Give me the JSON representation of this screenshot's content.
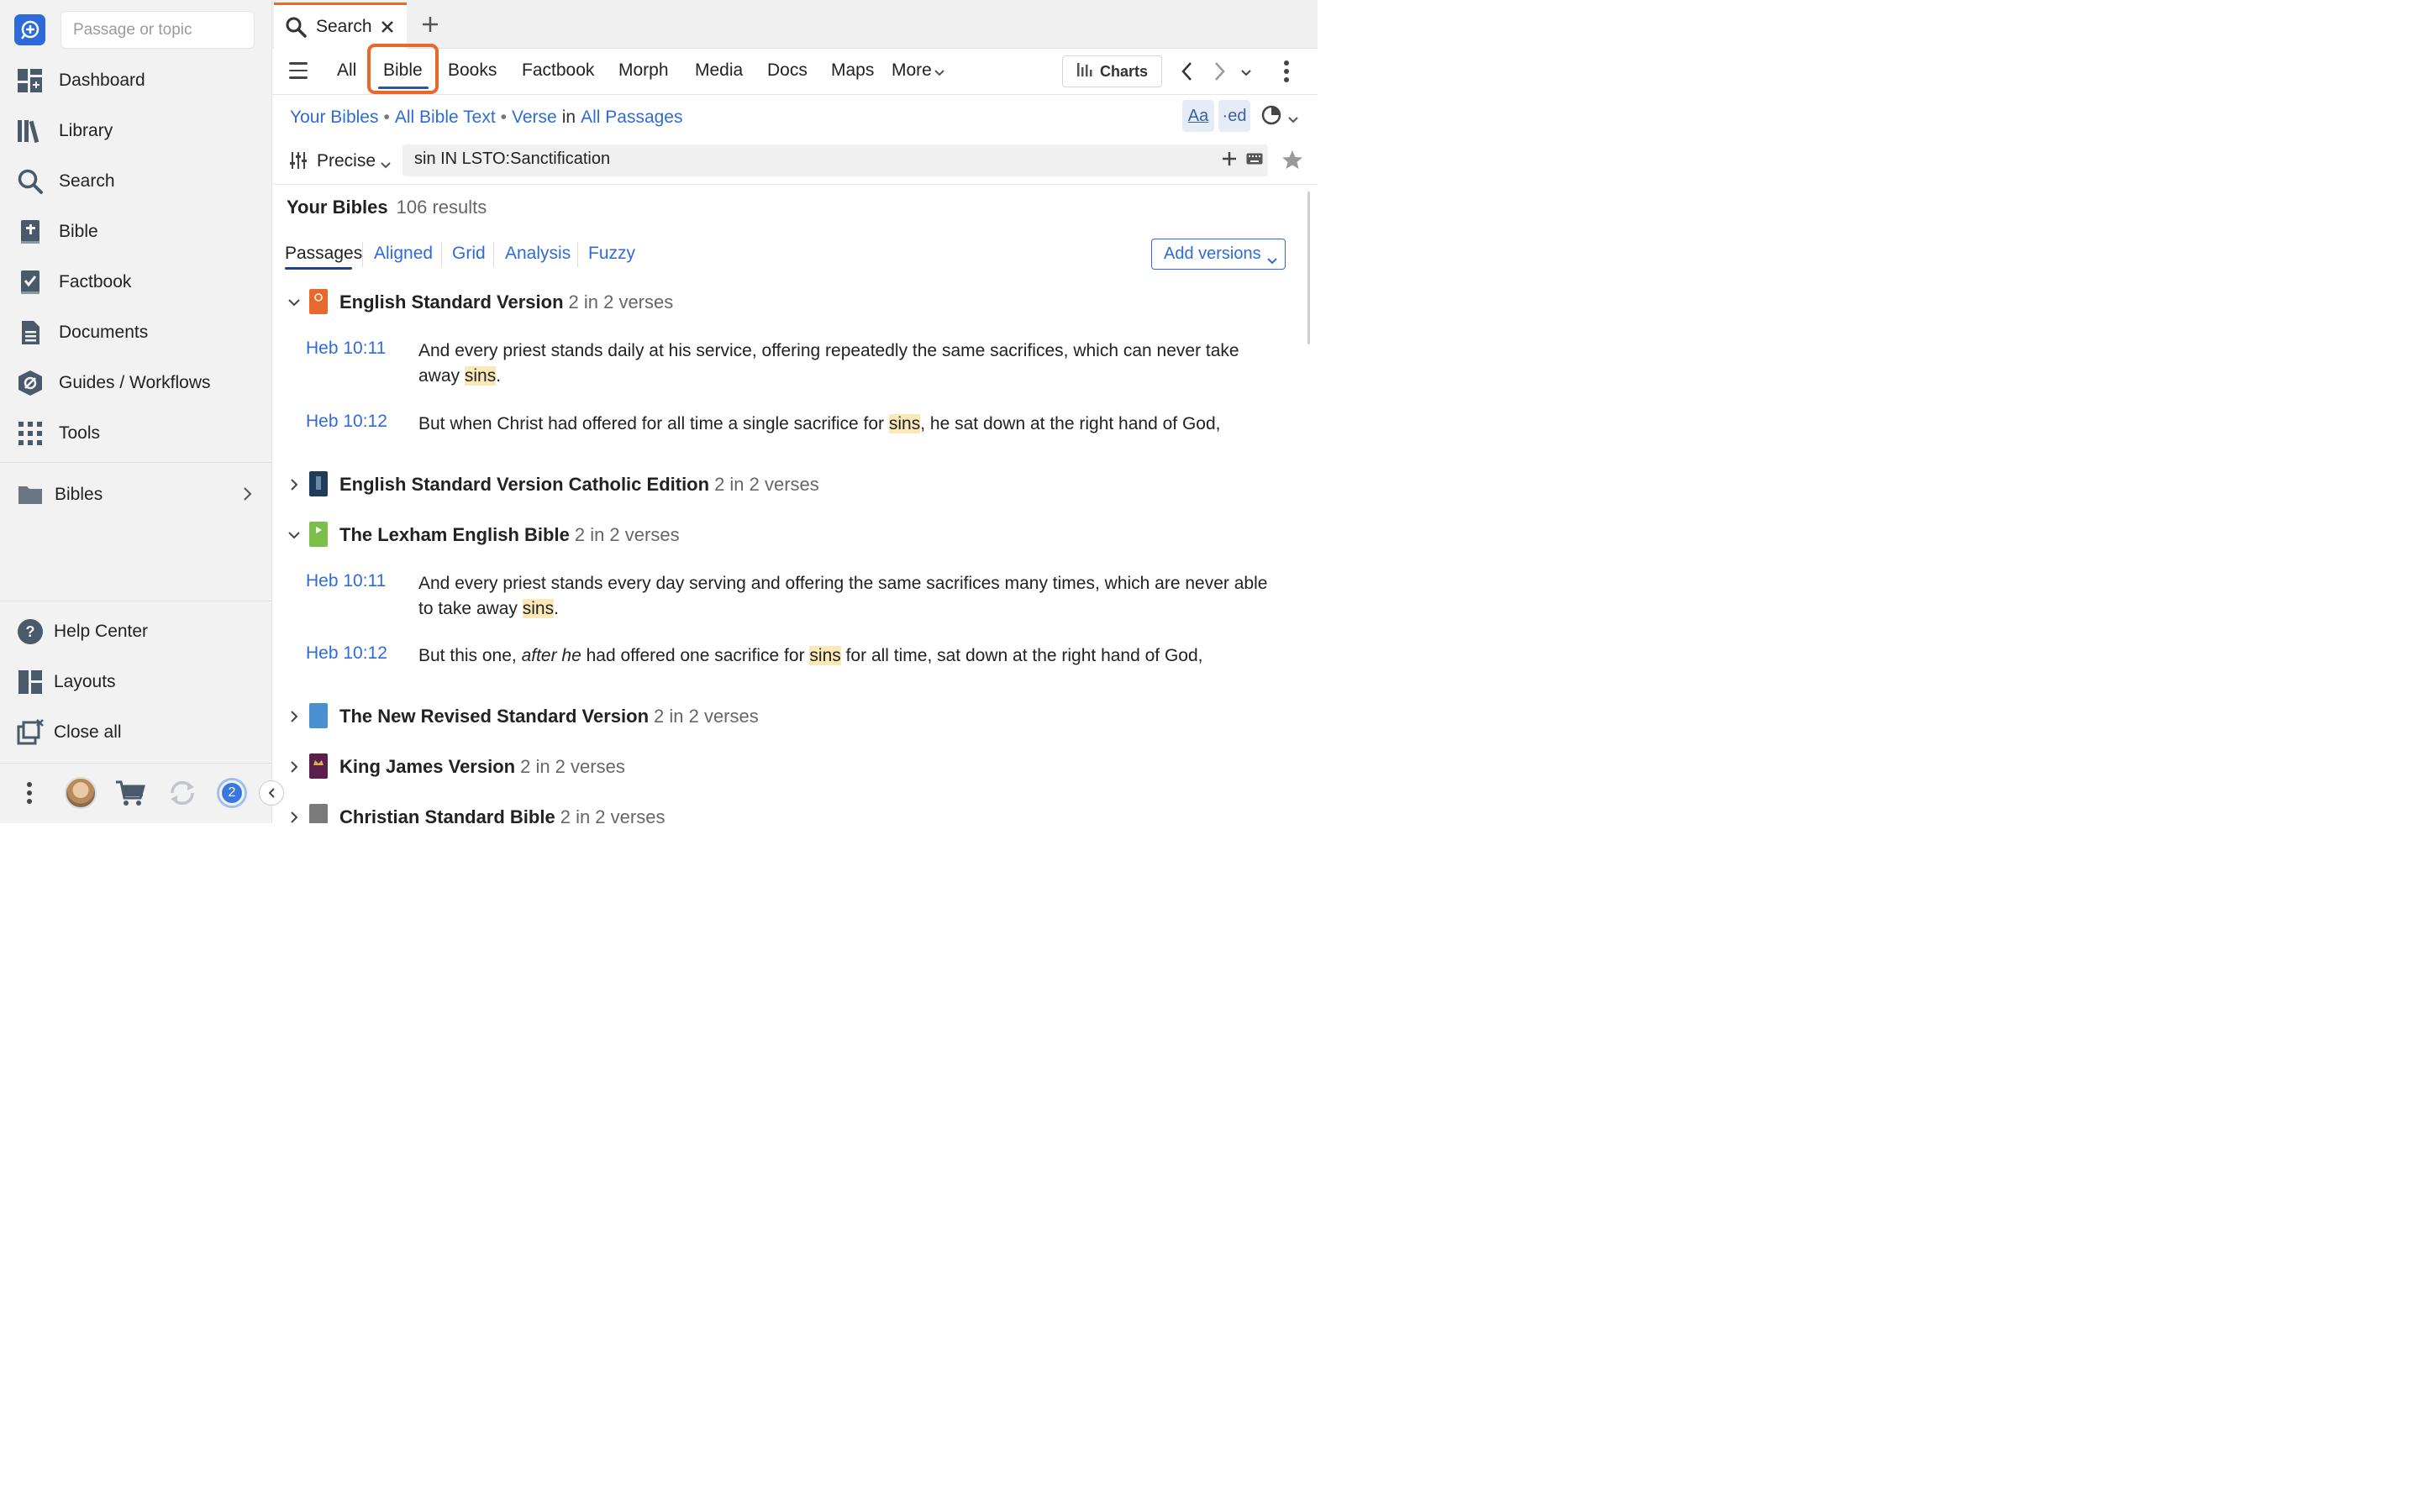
{
  "sidebar": {
    "search_placeholder": "Passage or topic",
    "items": [
      {
        "label": "Dashboard",
        "icon": "dashboard-icon"
      },
      {
        "label": "Library",
        "icon": "library-icon"
      },
      {
        "label": "Search",
        "icon": "search-icon"
      },
      {
        "label": "Bible",
        "icon": "bible-icon"
      },
      {
        "label": "Factbook",
        "icon": "factbook-icon"
      },
      {
        "label": "Documents",
        "icon": "documents-icon"
      },
      {
        "label": "Guides / Workflows",
        "icon": "guides-icon"
      },
      {
        "label": "Tools",
        "icon": "tools-icon"
      }
    ],
    "folder": {
      "label": "Bibles"
    },
    "bottom": [
      {
        "label": "Help Center"
      },
      {
        "label": "Layouts"
      },
      {
        "label": "Close all"
      }
    ],
    "footer": {
      "badge_count": "2"
    }
  },
  "tabs": {
    "active_title": "Search"
  },
  "toolbar": {
    "categories": [
      "All",
      "Bible",
      "Books",
      "Factbook",
      "Morph",
      "Media",
      "Docs",
      "Maps",
      "More"
    ],
    "selected": "Bible",
    "charts_label": "Charts"
  },
  "crumbs": {
    "scope": "Your Bibles",
    "text": "All Bible Text",
    "unit": "Verse",
    "in": "in",
    "range": "All Passages"
  },
  "display_buttons": {
    "font": "Aa",
    "ed": "ed"
  },
  "search": {
    "mode": "Precise",
    "query": "sin IN LSTO:Sanctification"
  },
  "results": {
    "title": "Your Bibles",
    "count": "106 results",
    "subtabs": [
      "Passages",
      "Aligned",
      "Grid",
      "Analysis",
      "Fuzzy"
    ],
    "active_subtab": "Passages",
    "add_versions": "Add versions",
    "versions": [
      {
        "name": "English Standard Version",
        "count": "2 in 2 verses",
        "expanded": true,
        "book_color": "#e8692b",
        "verses": [
          {
            "ref": "Heb 10:11",
            "pre": "And every priest stands daily at his service, offering repeatedly the same sacrifices, which can never take away ",
            "hit": "sins",
            "post": "."
          },
          {
            "ref": "Heb 10:12",
            "pre": "But when Christ had offered for all time a single sacrifice for ",
            "hit": "sins",
            "post": ", he sat down at the right hand of God,"
          }
        ]
      },
      {
        "name": "English Standard Version Catholic Edition",
        "count": "2 in 2 verses",
        "expanded": false,
        "book_color": "#1f3c5a"
      },
      {
        "name": "The Lexham English Bible",
        "count": "2 in 2 verses",
        "expanded": true,
        "book_color": "#7bbf4a",
        "verses": [
          {
            "ref": "Heb 10:11",
            "pre": "And every priest stands every day serving and offering the same sacrifices many times, which are never able to take away ",
            "hit": "sins",
            "post": "."
          },
          {
            "ref": "Heb 10:12",
            "pre": "But this one, ",
            "ital": "after he",
            "mid": " had offered one sacrifice for ",
            "hit": "sins",
            "post": " for all time, sat down at the right hand of God,"
          }
        ]
      },
      {
        "name": "The New Revised Standard Version",
        "count": "2 in 2 verses",
        "expanded": false,
        "book_color": "#4a8fd0"
      },
      {
        "name": "King James Version",
        "count": "2 in 2 verses",
        "expanded": false,
        "book_color": "#5a1f4a"
      },
      {
        "name": "Christian Standard Bible",
        "count": "2 in 2 verses",
        "expanded": false,
        "book_color": "#7a7a7a"
      }
    ]
  },
  "colors": {
    "accent": "#2f6bd8",
    "highlight": "#fbe8b8",
    "tab_accent": "#e8692b"
  }
}
